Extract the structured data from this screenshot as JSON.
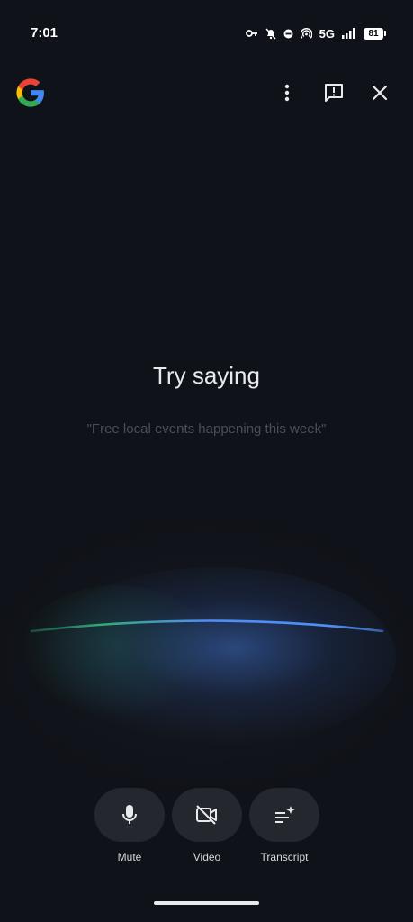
{
  "status_bar": {
    "time": "7:01",
    "network": "5G",
    "battery": "81",
    "icons": [
      "key-icon",
      "mute-bell-icon",
      "dnd-icon",
      "hotspot-icon",
      "signal-icon",
      "battery-icon"
    ]
  },
  "top_bar": {
    "logo": "google-logo",
    "icons": [
      "more-vert-icon",
      "feedback-icon",
      "close-icon"
    ]
  },
  "prompt": {
    "title": "Try saying",
    "example": "\"Free local events happening this week\""
  },
  "controls": [
    {
      "label": "Mute",
      "icon": "mic-icon"
    },
    {
      "label": "Video",
      "icon": "video-off-icon"
    },
    {
      "label": "Transcript",
      "icon": "transcript-icon"
    }
  ],
  "colors": {
    "background": "#0f1218",
    "button_bg": "#24272e",
    "wave_blue": "#4f8ef7",
    "wave_green": "#34a878",
    "google_blue": "#4285F4",
    "google_red": "#EA4335",
    "google_yellow": "#FBBC05",
    "google_green": "#34A853"
  }
}
